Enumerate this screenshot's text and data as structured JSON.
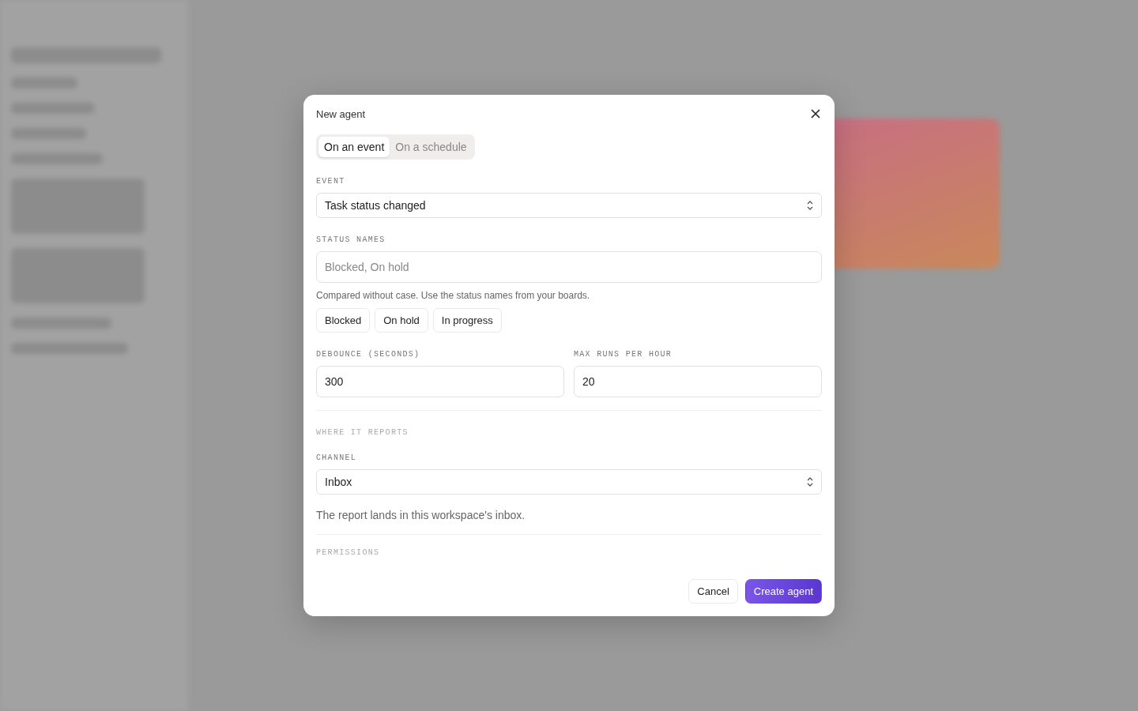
{
  "dialog": {
    "title": "New agent",
    "trigger_tabs": [
      {
        "label": "On an event",
        "selected": true
      },
      {
        "label": "On a schedule",
        "selected": false
      }
    ],
    "event": {
      "label": "EVENT",
      "value": "Task status changed"
    },
    "status_names": {
      "label": "STATUS NAMES",
      "placeholder": "Blocked, On hold",
      "hint": "Compared without case. Use the status names from your boards.",
      "chips": [
        "Blocked",
        "On hold",
        "In progress"
      ]
    },
    "debounce": {
      "label": "DEBOUNCE (SECONDS)",
      "value": "300"
    },
    "max_runs": {
      "label": "MAX RUNS PER HOUR",
      "value": "20"
    },
    "reports_section": "WHERE IT REPORTS",
    "channel": {
      "label": "CHANNEL",
      "value": "Inbox",
      "hint": "The report lands in this workspace's inbox."
    },
    "permissions_section": "PERMISSIONS",
    "buttons": [
      {
        "label": "Cancel",
        "kind": "secondary"
      },
      {
        "label": "Create agent",
        "kind": "primary"
      }
    ]
  }
}
